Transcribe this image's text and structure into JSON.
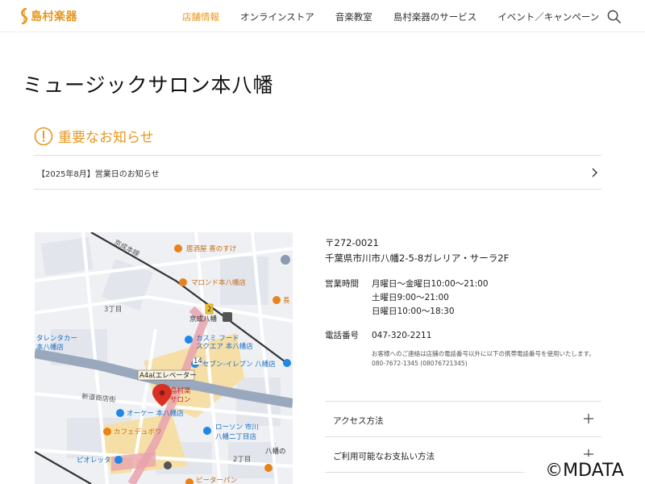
{
  "header": {
    "logo_text": "島村楽器",
    "nav": [
      {
        "label": "店舗情報",
        "active": true
      },
      {
        "label": "オンラインストア",
        "active": false
      },
      {
        "label": "音楽教室",
        "active": false
      },
      {
        "label": "島村楽器のサービス",
        "active": false
      },
      {
        "label": "イベント／キャンペーン",
        "active": false
      }
    ],
    "icons": {
      "search": "search-icon"
    }
  },
  "page_title": "ミュージックサロン本八幡",
  "notice": {
    "title": "重要なお知らせ",
    "item": "【2025年8月】営業日のお知らせ"
  },
  "map": {
    "labels": {
      "keisei_line": "京成本線",
      "izakaya": "居酒屋 喜のすけ",
      "marudon": "マロンド本八幡店",
      "chome3": "3丁目",
      "keisei_station": "京成八幡",
      "kasumi": "カスミ フード",
      "kasumi2": "スクエア 本八幡店",
      "talent": "タレンタカー",
      "talent2": "本八幡店",
      "seven": "セブン-イレブン 八幡店",
      "exit": "A4a(エレベーター",
      "store": "島村楽",
      "store2": "サロン",
      "okay": "オーケー 本八幡店",
      "cafe": "カフェデュボワ",
      "lawson": "ローソン 市川",
      "lawson2": "八幡二丁目店",
      "chome2": "2丁目",
      "yawata": "八幡の",
      "pioretta": "ピオレッタ",
      "peter": "ピーターパン",
      "naga": "長",
      "keisei_street": "新道商店街",
      "num2": "2",
      "num14": "14"
    },
    "colors": {
      "road": "#9aa8bd",
      "rail": "#e8a3ae",
      "pin": "#d93025",
      "poi_orange": "#e8821c",
      "poi_blue": "#1e88e5"
    }
  },
  "store": {
    "postal": "〒272-0021",
    "address": "千葉県市川市八幡2-5-8ガレリア・サーラ2F",
    "hours_label": "営業時間",
    "hours": [
      "月曜日～金曜日10:00～21:00",
      "土曜日9:00～21:00",
      "日曜日10:00～18:30"
    ],
    "phone_label": "電話番号",
    "phone": "047-320-2211",
    "phone_note": "お客様へのご連絡は店舗の電話番号以外に以下の携帯電話番号を使用いたします。",
    "alt_phone": "080-7672-1345 (08076721345)"
  },
  "accordions": [
    {
      "label": "アクセス方法"
    },
    {
      "label": "ご利用可能なお支払い方法"
    }
  ],
  "watermark": "©MDATA",
  "accent_color": "#e8961c"
}
